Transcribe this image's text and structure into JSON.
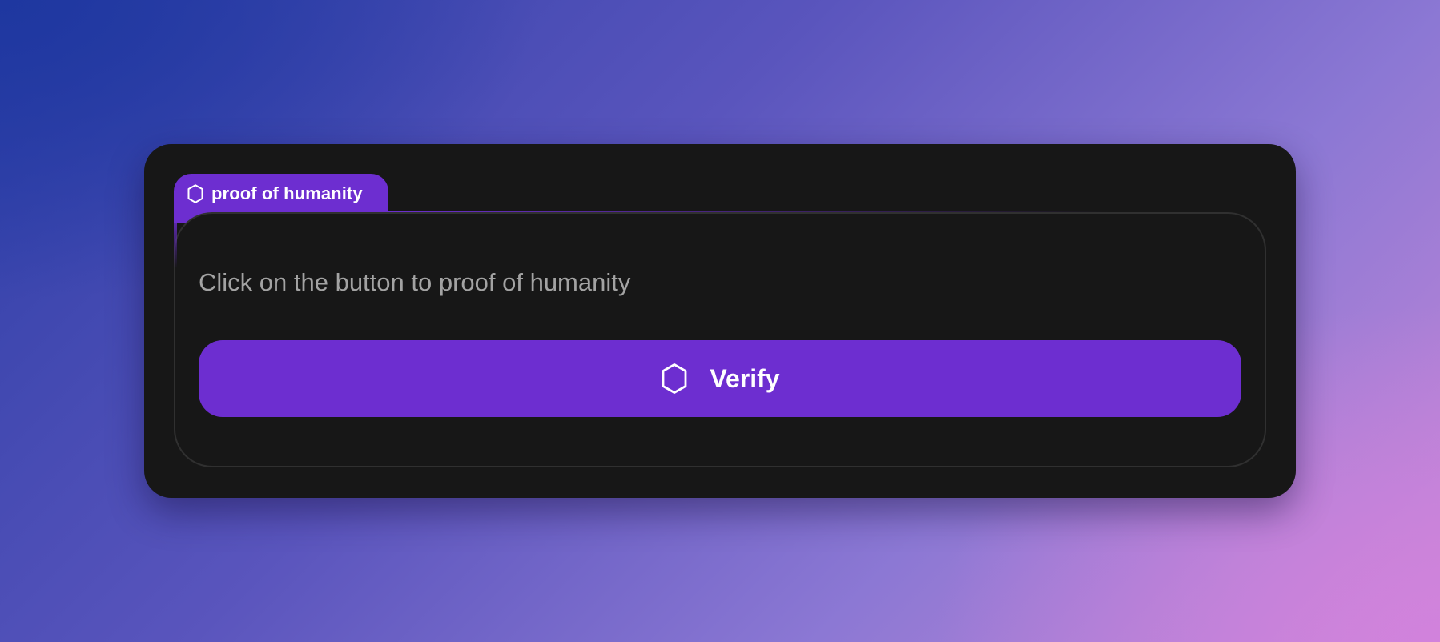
{
  "colors": {
    "accent": "#6d2ed0",
    "card_background": "#171717",
    "panel_border": "#303030",
    "prompt_text": "#a3a3a3",
    "button_text": "#ffffff"
  },
  "widget": {
    "tab": {
      "icon": "shield-icon",
      "label": "proof of humanity"
    },
    "prompt": "Click on the button to proof of humanity",
    "verify_button": {
      "icon": "shield-icon",
      "label": "Verify"
    }
  }
}
